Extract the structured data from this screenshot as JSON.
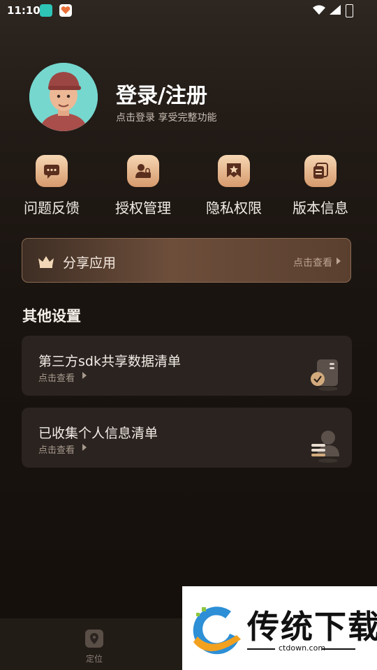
{
  "status_bar": {
    "time": "11:10"
  },
  "profile": {
    "title": "登录/注册",
    "subtitle": "点击登录 享受完整功能"
  },
  "quick_actions": [
    {
      "label": "问题反馈",
      "icon": "chat-icon"
    },
    {
      "label": "授权管理",
      "icon": "user-lock-icon"
    },
    {
      "label": "隐私权限",
      "icon": "star-badge-icon"
    },
    {
      "label": "版本信息",
      "icon": "copy-doc-icon"
    }
  ],
  "share": {
    "title": "分享应用",
    "link": "点击查看"
  },
  "other_settings": {
    "title": "其他设置",
    "items": [
      {
        "title": "第三方sdk共享数据清单",
        "sub": "点击查看"
      },
      {
        "title": "已收集个人信息清单",
        "sub": "点击查看"
      }
    ]
  },
  "tabbar": {
    "items": [
      {
        "label": "定位"
      }
    ]
  },
  "watermark": {
    "name": "传统下载",
    "url": "ctdown.com"
  },
  "colors": {
    "accent": "#d69a6c",
    "background": "#1a1410",
    "card": "#2a231f",
    "avatar_bg": "#76d7cf"
  }
}
